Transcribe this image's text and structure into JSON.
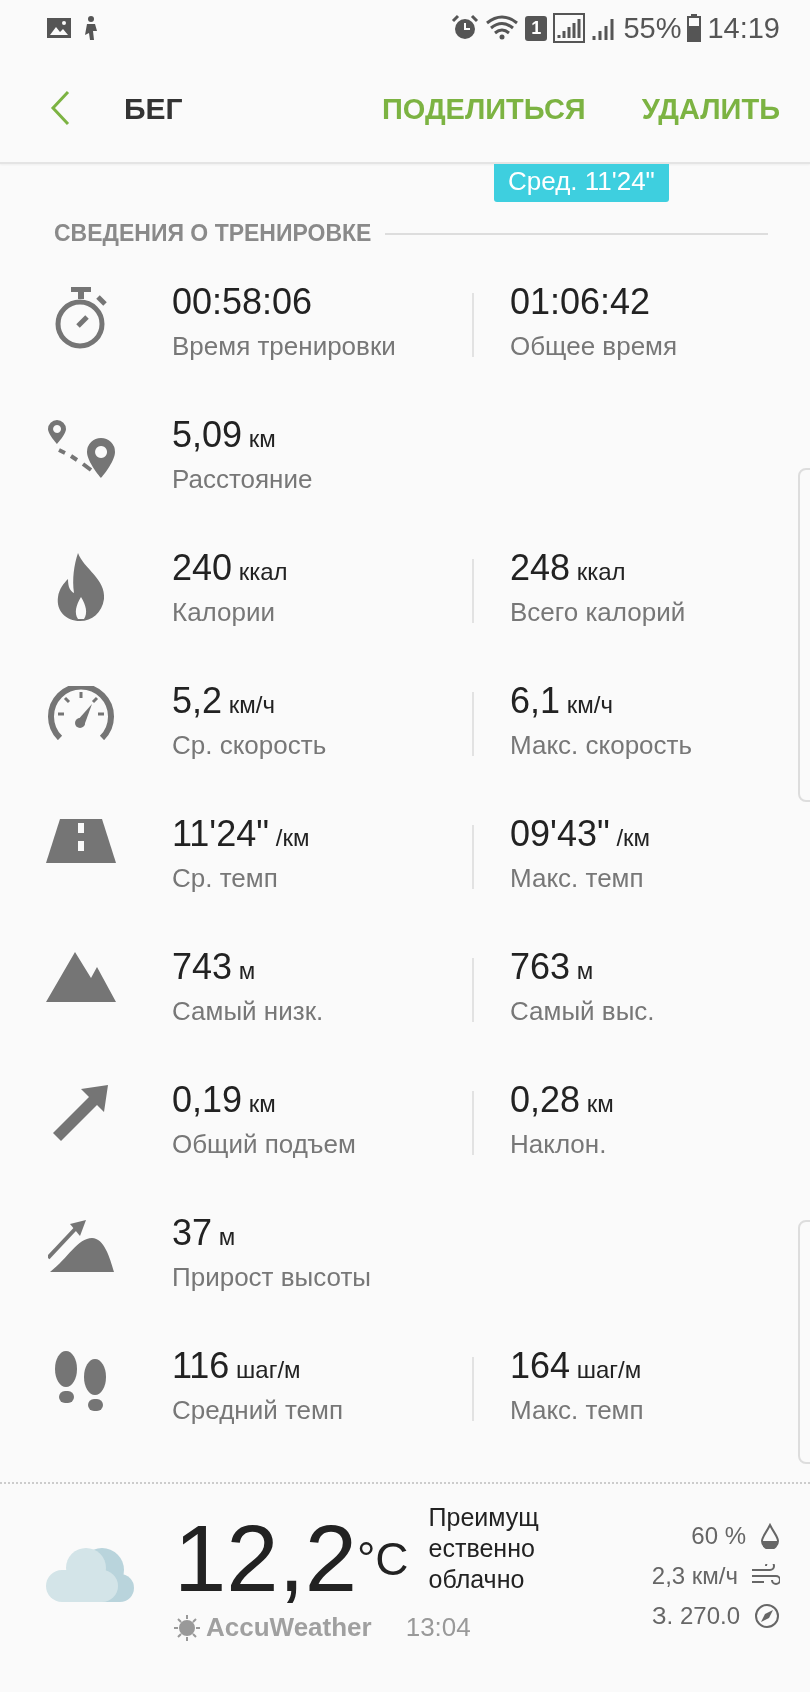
{
  "status_bar": {
    "sim_slot": "1",
    "battery_text": "55%",
    "time": "14:19"
  },
  "header": {
    "title": "БЕГ",
    "actions": [
      "ПОДЕЛИТЬСЯ",
      "УДАЛИТЬ"
    ]
  },
  "pace_badge": "Сред. 11'24\"",
  "section_title": "СВЕДЕНИЯ О ТРЕНИРОВКЕ",
  "stats": [
    {
      "kind": "stopwatch",
      "left": {
        "value": "00:58:06",
        "label": "Время тренировки"
      },
      "right": {
        "value": "01:06:42",
        "label": "Общее время"
      }
    },
    {
      "kind": "route",
      "left": {
        "value": "5,09",
        "unit": "км",
        "label": "Расстояние"
      }
    },
    {
      "kind": "flame",
      "left": {
        "value": "240",
        "unit": "ккал",
        "label": "Калории"
      },
      "right": {
        "value": "248",
        "unit": "ккал",
        "label": "Всего калорий"
      }
    },
    {
      "kind": "speed",
      "left": {
        "value": "5,2",
        "unit": "км/ч",
        "label": "Ср. скорость"
      },
      "right": {
        "value": "6,1",
        "unit": "км/ч",
        "label": "Макс. скорость"
      }
    },
    {
      "kind": "road",
      "left": {
        "value": "11'24\"",
        "unit": "/км",
        "label": "Ср. темп"
      },
      "right": {
        "value": "09'43\"",
        "unit": "/км",
        "label": "Макс. темп"
      }
    },
    {
      "kind": "mountain",
      "left": {
        "value": "743",
        "unit": "м",
        "label": "Самый низк."
      },
      "right": {
        "value": "763",
        "unit": "м",
        "label": "Самый выс."
      }
    },
    {
      "kind": "arrow",
      "left": {
        "value": "0,19",
        "unit": "км",
        "label": "Общий подъем"
      },
      "right": {
        "value": "0,28",
        "unit": "км",
        "label": "Наклон."
      }
    },
    {
      "kind": "climb",
      "left": {
        "value": "37",
        "unit": "м",
        "label": "Прирост высоты"
      }
    },
    {
      "kind": "steps",
      "left": {
        "value": "116",
        "unit": "шаг/м",
        "label": "Средний темп"
      },
      "right": {
        "value": "164",
        "unit": "шаг/м",
        "label": "Макс. темп"
      }
    }
  ],
  "weather": {
    "temperature": "12,2",
    "unit": "°C",
    "condition_lines": [
      "Преимущ",
      "ественно",
      "облачно"
    ],
    "provider": "AccuWeather",
    "time": "13:04",
    "details": [
      {
        "kind": "humidity",
        "text": "60 %"
      },
      {
        "kind": "wind",
        "text": "2,3 км/ч"
      },
      {
        "kind": "direction",
        "text": "З. 270.0"
      }
    ]
  }
}
